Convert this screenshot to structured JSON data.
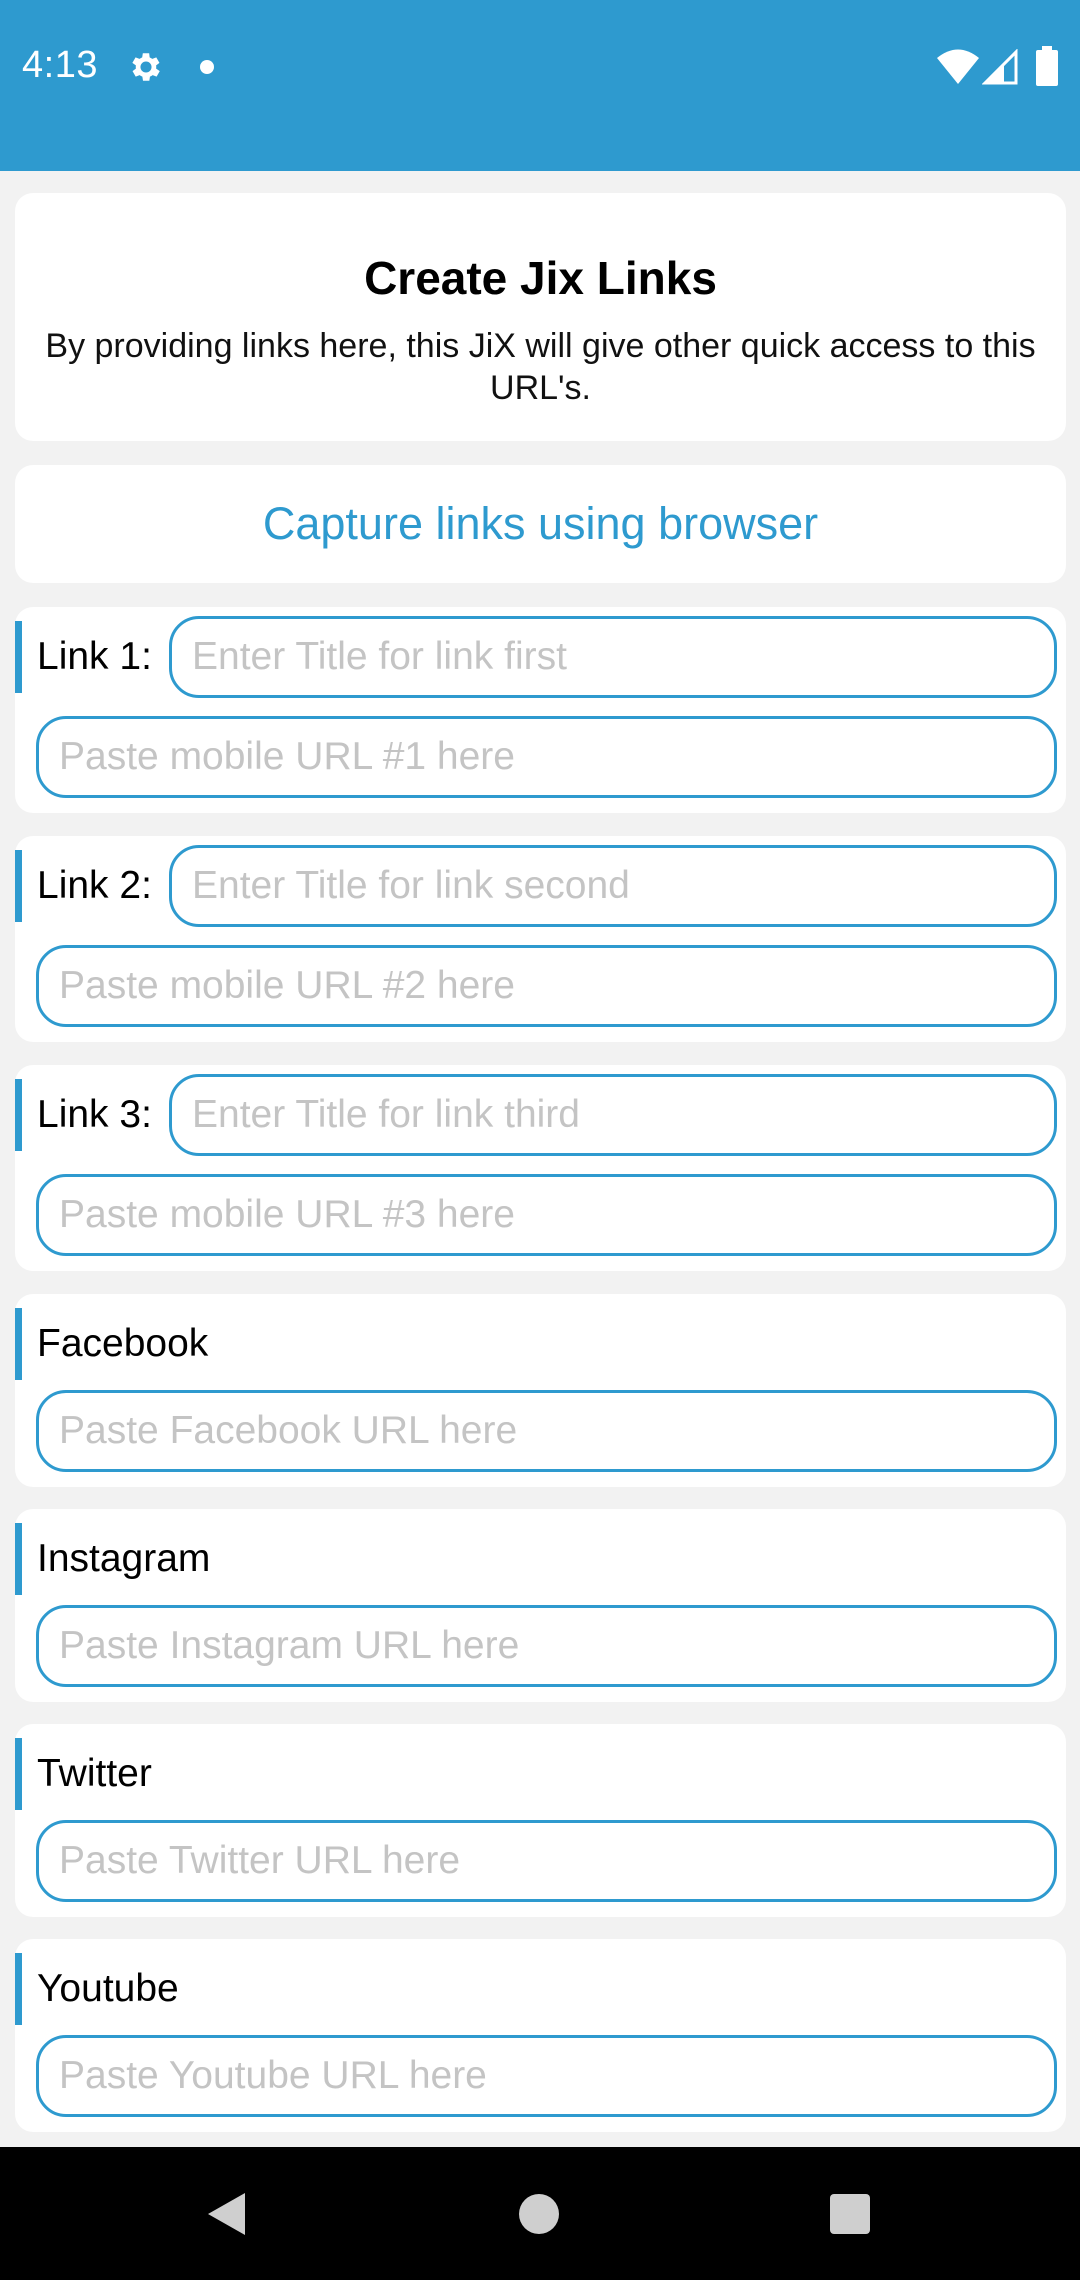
{
  "status_bar": {
    "time": "4:13",
    "icons": [
      "gear-icon",
      "notification-dot-icon",
      "wifi-icon",
      "signal-icon",
      "battery-icon"
    ],
    "background": "#2e9acf"
  },
  "header": {
    "title": "Create Jix Links",
    "description": "By providing links here, this JiX will give other quick access to this URL's."
  },
  "capture": {
    "label": "Capture links using browser"
  },
  "links": [
    {
      "label": "Link 1:",
      "title_placeholder": "Enter Title for link first",
      "url_placeholder": "Paste mobile URL #1 here"
    },
    {
      "label": "Link 2:",
      "title_placeholder": "Enter Title for link second",
      "url_placeholder": "Paste mobile URL #2 here"
    },
    {
      "label": "Link 3:",
      "title_placeholder": "Enter Title for link third",
      "url_placeholder": "Paste mobile URL #3 here"
    }
  ],
  "social": [
    {
      "label": "Facebook",
      "placeholder": "Paste Facebook URL here"
    },
    {
      "label": "Instagram",
      "placeholder": "Paste Instagram URL here"
    },
    {
      "label": "Twitter",
      "placeholder": "Paste Twitter URL here"
    },
    {
      "label": "Youtube",
      "placeholder": "Paste Youtube URL here"
    }
  ],
  "nav_bar": {
    "icons": [
      "back-icon",
      "home-icon",
      "recents-icon"
    ]
  },
  "colors": {
    "accent": "#2e9acf",
    "background": "#f2f2f2",
    "card": "#ffffff",
    "placeholder": "#c4c4c4"
  }
}
